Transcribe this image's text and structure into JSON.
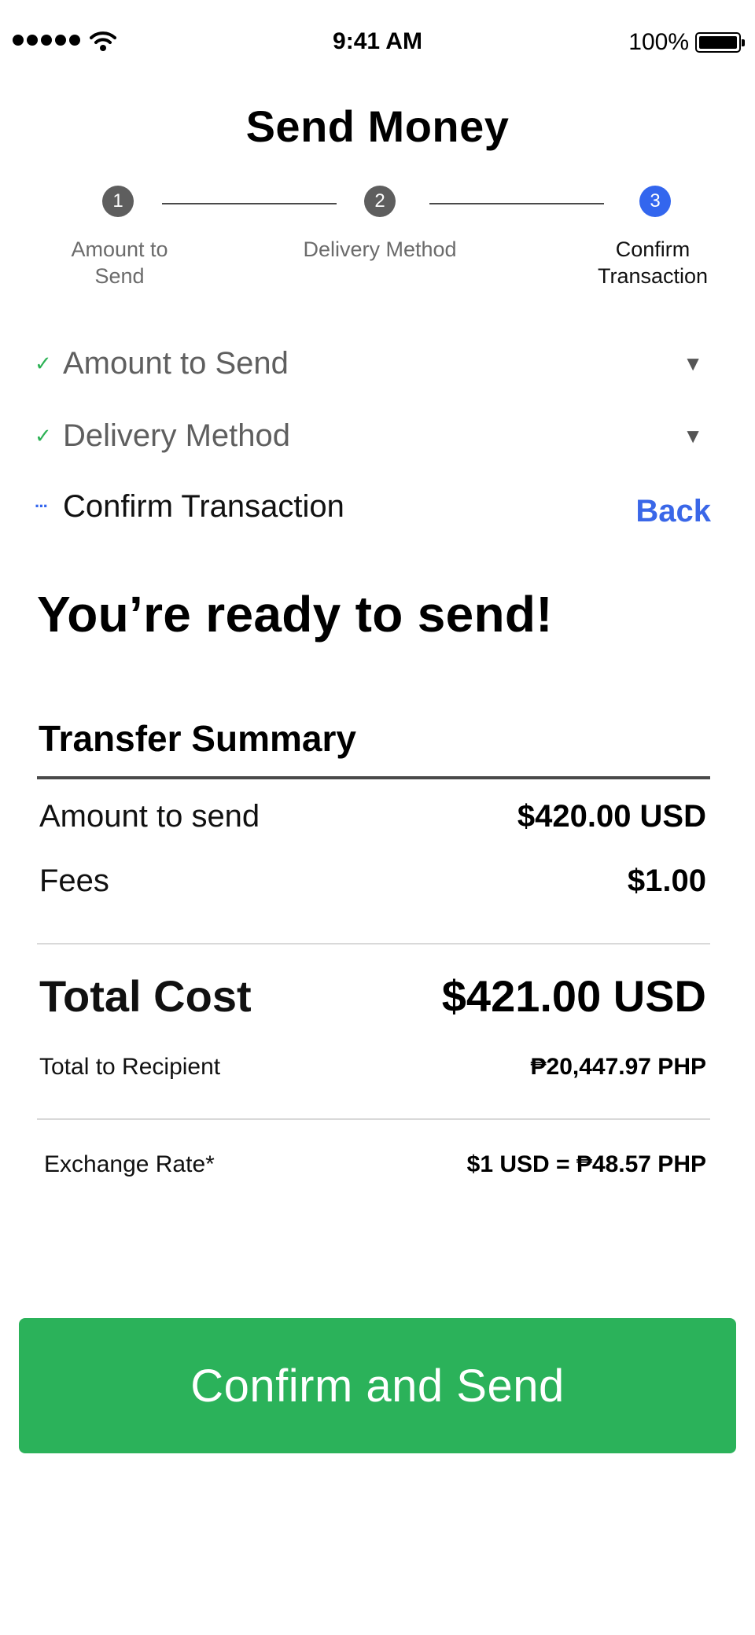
{
  "status_bar": {
    "time": "9:41 AM",
    "battery_percent": "100%",
    "signal_icon": "signal-dots-icon",
    "wifi_icon": "wifi-icon",
    "battery_icon": "battery-icon"
  },
  "header": {
    "title": "Send Money"
  },
  "stepper": {
    "steps": [
      {
        "number": "1",
        "label_line1": "Amount to",
        "label_line2": "Send",
        "state": "done"
      },
      {
        "number": "2",
        "label_line1": "Delivery Method",
        "label_line2": "",
        "state": "done"
      },
      {
        "number": "3",
        "label_line1": "Confirm",
        "label_line2": "Transaction",
        "state": "active"
      }
    ]
  },
  "progress": {
    "items": [
      {
        "mark": "✓",
        "label": "Amount to Send",
        "caret": "▼"
      },
      {
        "mark": "✓",
        "label": "Delivery Method",
        "caret": "▼"
      },
      {
        "mark": "···",
        "label": "Confirm Transaction",
        "action": "Back"
      }
    ]
  },
  "main": {
    "heading": "You’re ready to send!",
    "summary_title": "Transfer Summary",
    "amount_label": "Amount to send",
    "amount_value": "$420.00 USD",
    "fees_label": "Fees",
    "fees_value": "$1.00",
    "total_label": "Total Cost",
    "total_value": "$421.00 USD",
    "recipient_label": "Total to Recipient",
    "recipient_value": "₱20,447.97 PHP",
    "rate_label": "Exchange Rate*",
    "rate_value": "$1 USD = ₱48.57 PHP"
  },
  "actions": {
    "confirm_label": "Confirm and Send"
  },
  "colors": {
    "accent_blue": "#3366ee",
    "success_green": "#2bb25a",
    "check_green": "#2db255",
    "step_grey": "#5e5e5e"
  }
}
